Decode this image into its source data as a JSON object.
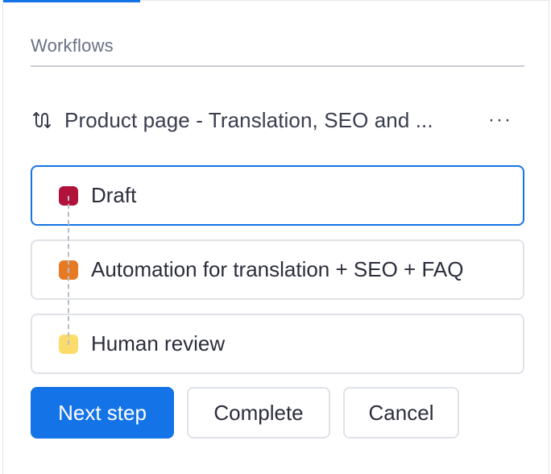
{
  "section": {
    "label": "Workflows"
  },
  "workflow": {
    "title": "Product page - Translation, SEO and ...",
    "icon": "flow-arrows-icon",
    "more_label": "···"
  },
  "steps": [
    {
      "label": "Draft",
      "color": "#b0123b",
      "active": true
    },
    {
      "label": "Automation for translation + SEO + FAQ",
      "color": "#e67a25",
      "active": false
    },
    {
      "label": "Human review",
      "color": "#fbdc6b",
      "active": false
    }
  ],
  "actions": {
    "next_step": "Next step",
    "complete": "Complete",
    "cancel": "Cancel"
  },
  "colors": {
    "accent": "#1473e6",
    "border": "#dfe2e8"
  }
}
